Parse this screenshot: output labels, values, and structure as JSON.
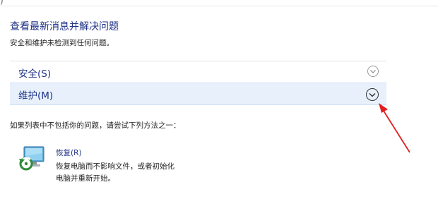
{
  "top_edge": {
    "glyph": ")"
  },
  "header": {
    "title": "查看最新消息并解决问题",
    "subtitle": "安全和维护未检测到任何问题。"
  },
  "sections": [
    {
      "label": "安全(S)",
      "icon": "chevron-down-icon",
      "highlighted": false
    },
    {
      "label": "维护(M)",
      "icon": "chevron-down-icon",
      "highlighted": true
    }
  ],
  "hint": "如果列表中不包括你的问题，请尝试下列方法之一：",
  "recovery": {
    "icon": "recovery-icon",
    "link_label": "恢复(R)",
    "description": "恢复电脑而不影响文件，或者初始化电脑并重新开始。"
  },
  "annotation": {
    "icon": "red-arrow-icon",
    "color": "#e02020"
  },
  "colors": {
    "link": "#1e3287",
    "highlight_row": "#e8f1fb",
    "arrow": "#e02020"
  }
}
